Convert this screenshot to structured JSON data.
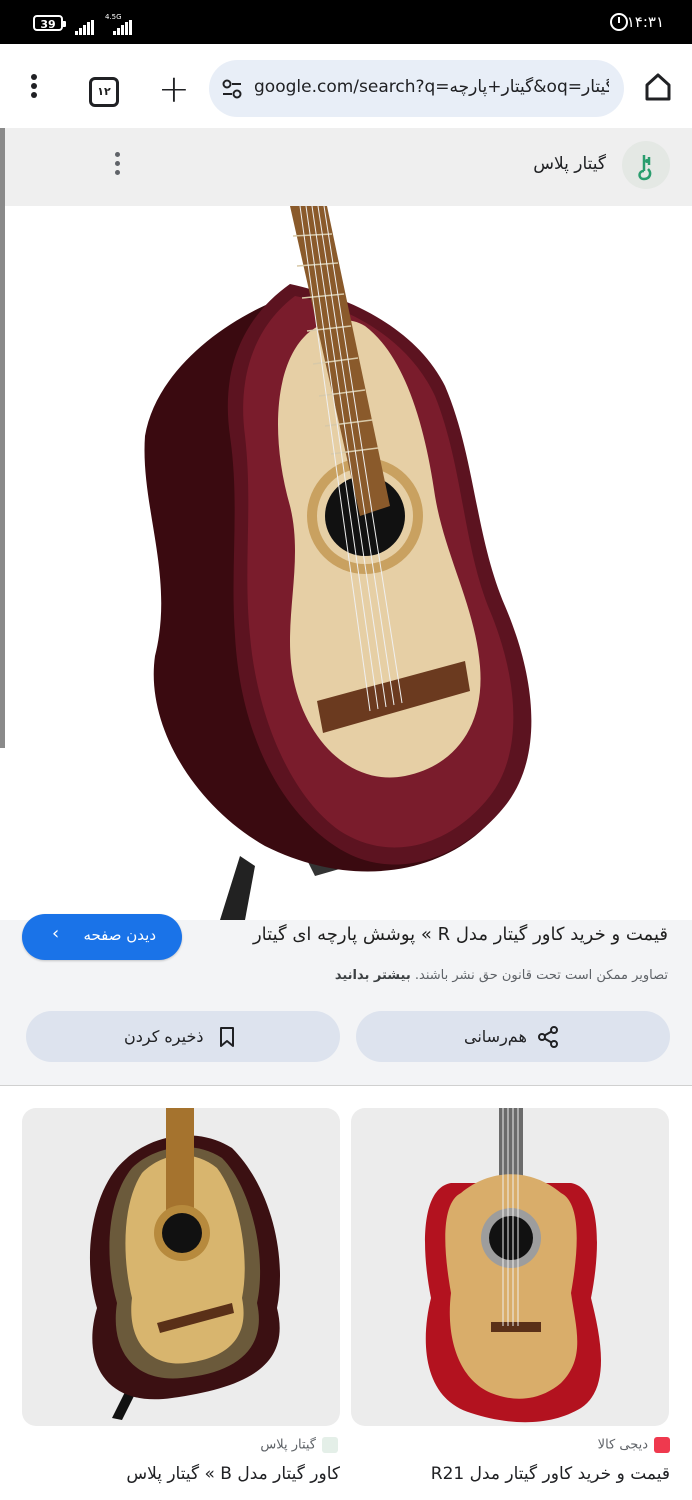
{
  "status_bar": {
    "battery": "39",
    "network": "4.5G",
    "time": "۱۴:۳۱"
  },
  "toolbar": {
    "tab_count": "۱۲",
    "url": "google.com/search?q=گیتار+پارچه&oq=گیتار"
  },
  "site": {
    "name": "گیتار پلاس"
  },
  "result": {
    "visit_label": "دیدن صفحه",
    "title": "قیمت و خرید کاور گیتار مدل R » پوشش پارچه ای گیتار",
    "copyright_text": "تصاویر ممکن است تحت قانون حق نشر باشند.",
    "learn_more": "بیشتر بدانید",
    "share_label": "هم‌رسانی",
    "save_label": "ذخیره کردن"
  },
  "related": [
    {
      "source": "دیجی کالا",
      "title": "قیمت و خرید کاور گیتار مدل R21",
      "source_icon_color": "#ef394e"
    },
    {
      "source": "گیتار پلاس",
      "title": "کاور گیتار مدل B » گیتار پلاس",
      "source_icon_color": "#1a9e7a"
    }
  ]
}
